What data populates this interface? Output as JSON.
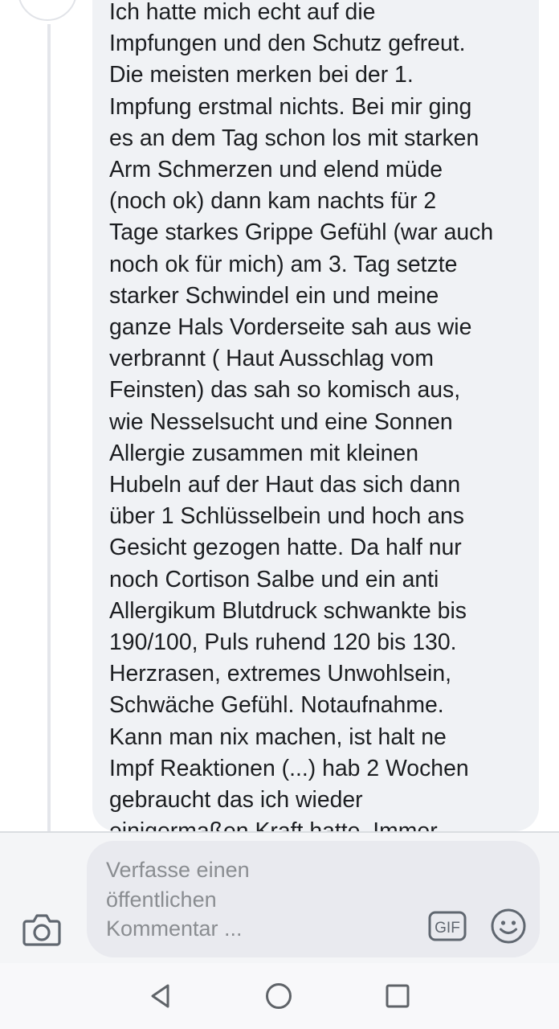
{
  "comment": {
    "text": "Ich hatte mich echt auf die\nImpfungen und den Schutz gefreut.\nDie meisten merken bei der 1.\nImpfung erstmal nichts. Bei mir ging\nes an dem Tag schon los mit starken\nArm Schmerzen und elend müde\n(noch ok) dann kam nachts für 2\nTage starkes Grippe Gefühl (war auch\nnoch ok für mich) am 3. Tag setzte\nstarker Schwindel ein und meine\nganze Hals Vorderseite sah aus wie\nverbrannt ( Haut Ausschlag vom\nFeinsten) das sah so komisch aus,\nwie Nesselsucht und eine Sonnen\nAllergie zusammen mit kleinen\nHubeln auf der Haut das sich dann\nüber 1 Schlüsselbein und hoch ans\nGesicht gezogen hatte. Da half nur\nnoch Cortison Salbe und ein anti\nAllergikum Blutdruck schwankte bis\n190/100, Puls ruhend 120 bis 130.\nHerzrasen, extremes Unwohlsein,\nSchwäche Gefühl. Notaufnahme.\nKann man nix machen, ist halt ne\nImpf Reaktionen (...) hab 2 Wochen\ngebraucht das ich wieder\neinigermaßen Kraft hatte. Immer"
  },
  "composer": {
    "placeholder": "Verfasse einen\nöffentlichen\nKommentar ...",
    "gif_label": "GIF"
  },
  "icons": {
    "camera": "camera-icon",
    "gif": "gif-icon",
    "emoji": "smiley-icon",
    "back": "nav-back-triangle-icon",
    "home": "nav-home-circle-icon",
    "recents": "nav-recents-square-icon"
  },
  "colors": {
    "bubble": "#f0f2f5",
    "text": "#1c1e21",
    "placeholder": "#8a8d91",
    "icon": "#606770"
  }
}
